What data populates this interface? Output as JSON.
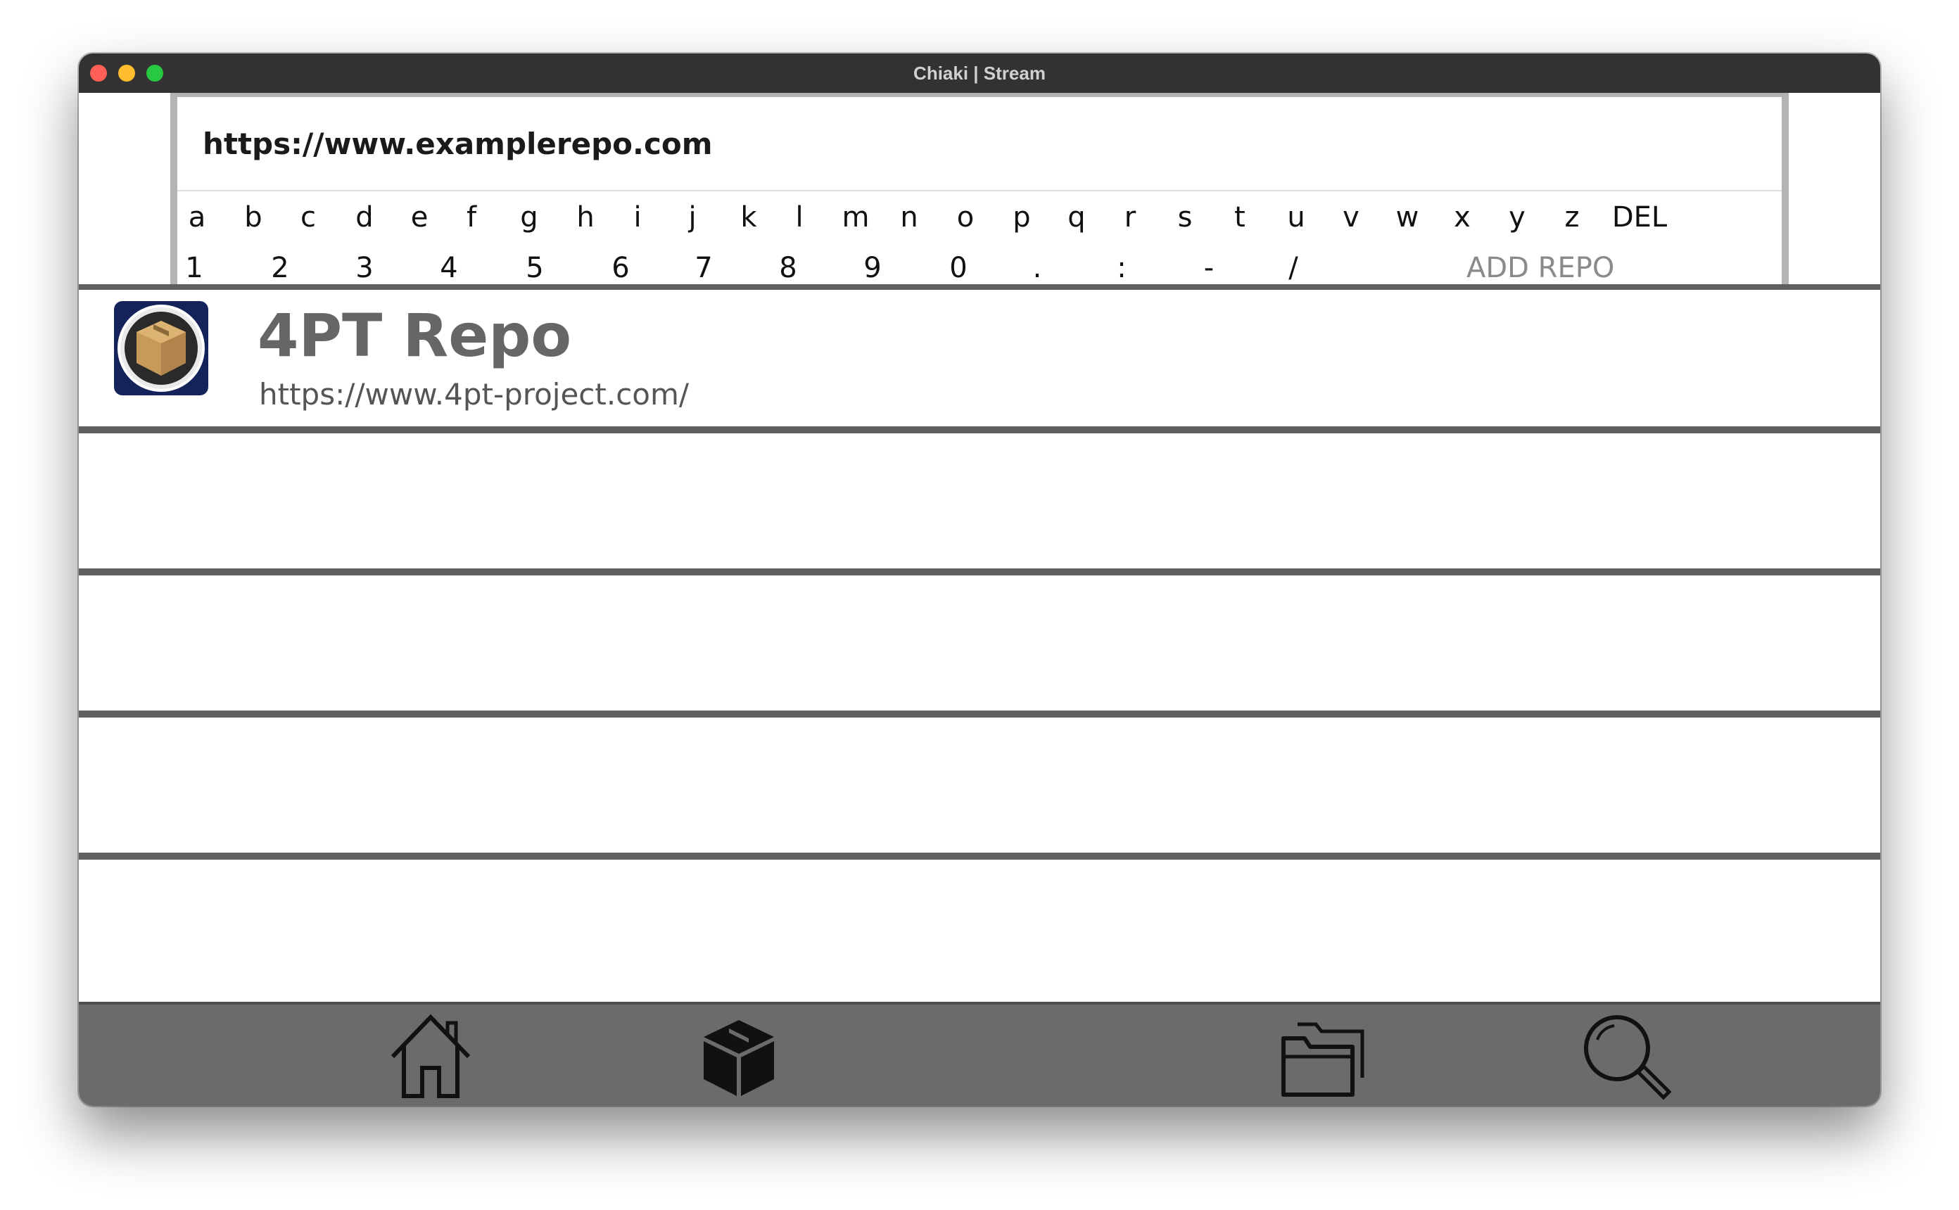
{
  "window": {
    "title": "Chiaki | Stream"
  },
  "keyboard": {
    "url_value": "https://www.examplerepo.com",
    "row1": [
      "a",
      "b",
      "c",
      "d",
      "e",
      "f",
      "g",
      "h",
      "i",
      "j",
      "k",
      "l",
      "m",
      "n",
      "o",
      "p",
      "q",
      "r",
      "s",
      "t",
      "u",
      "v",
      "w",
      "x",
      "y",
      "z",
      "DEL"
    ],
    "row2": [
      "1",
      "2",
      "3",
      "4",
      "5",
      "6",
      "7",
      "8",
      "9",
      "0",
      ".",
      ":",
      "-",
      "/"
    ],
    "add_repo_label": "ADD REPO"
  },
  "repos": [
    {
      "name": "4PT Repo",
      "url": "https://www.4pt-project.com/",
      "icon": "package-box-icon"
    }
  ],
  "empty_rows": 4,
  "bottom_nav": [
    {
      "icon": "home-icon"
    },
    {
      "icon": "package-icon"
    },
    {
      "icon": "folder-icon"
    },
    {
      "icon": "search-icon"
    }
  ],
  "colors": {
    "titlebar": "#323232",
    "separator": "#5f5f5f",
    "nav_bar": "#6b6b6b",
    "panel_border": "#b3b3b3",
    "repo_icon_bg": "#14245a"
  }
}
